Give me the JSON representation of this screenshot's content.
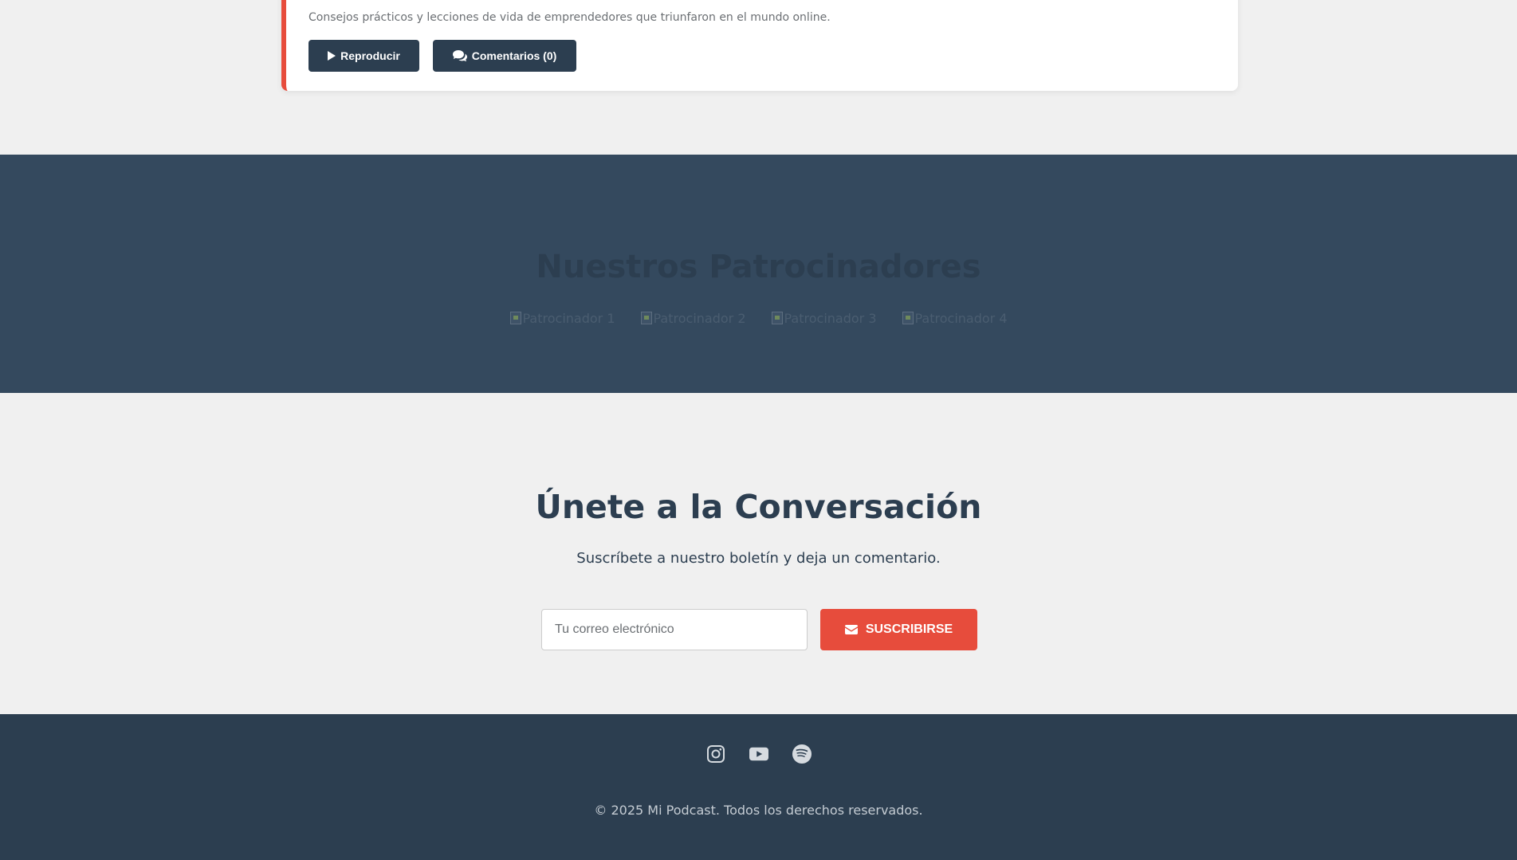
{
  "episode": {
    "description": "Consejos prácticos y lecciones de vida de emprendedores que triunfaron en el mundo online.",
    "play_label": "Reproducir",
    "comments_label": "Comentarios (0)"
  },
  "sponsors": {
    "title": "Nuestros Patrocinadores",
    "items": [
      {
        "alt": "Patrocinador 1"
      },
      {
        "alt": "Patrocinador 2"
      },
      {
        "alt": "Patrocinador 3"
      },
      {
        "alt": "Patrocinador 4"
      }
    ]
  },
  "newsletter": {
    "title": "Únete a la Conversación",
    "subtitle": "Suscríbete a nuestro boletín y deja un comentario.",
    "email_placeholder": "Tu correo electrónico",
    "subscribe_label": "SUSCRIBIRSE"
  },
  "footer": {
    "social": [
      {
        "icon": "instagram-icon"
      },
      {
        "icon": "youtube-icon"
      },
      {
        "icon": "spotify-icon"
      }
    ],
    "copyright": "© 2025 Mi Podcast. Todos los derechos reservados."
  },
  "colors": {
    "accent": "#e74c3c",
    "primary": "#2c3e50",
    "sponsors_bg": "#34495e",
    "page_bg": "#f0f0f0"
  }
}
